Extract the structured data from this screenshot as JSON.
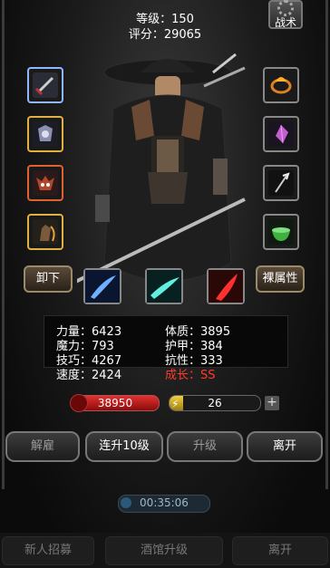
{
  "header": {
    "level_line": "等级：150",
    "score_line": "评分：29065",
    "tactics_label": "战术"
  },
  "equipment_left": [
    {
      "icon": "dagger-icon"
    },
    {
      "icon": "armor-icon"
    },
    {
      "icon": "demon-mask-icon"
    },
    {
      "icon": "claw-glove-icon"
    }
  ],
  "equipment_right": [
    {
      "icon": "fire-ring-icon"
    },
    {
      "icon": "crystal-gem-icon"
    },
    {
      "icon": "trident-icon"
    },
    {
      "icon": "jade-bowl-icon"
    }
  ],
  "buttons": {
    "unequip": "卸下",
    "base_attributes": "裸属性"
  },
  "skills": [
    "blue-slash-icon",
    "cyan-wind-icon",
    "red-blade-icon"
  ],
  "stats": [
    {
      "label": "力量：6423"
    },
    {
      "label": "体质：3895"
    },
    {
      "label": "魔力：793"
    },
    {
      "label": "护甲：384"
    },
    {
      "label": "技巧：4267"
    },
    {
      "label": "抗性：333"
    },
    {
      "label": "速度：2424"
    },
    {
      "label": "成长：SS"
    }
  ],
  "hp": {
    "value": "38950"
  },
  "energy": {
    "value": "26",
    "fraction": 0.15
  },
  "actions": {
    "dismiss": "解雇",
    "level_up_10": "连升10级",
    "upgrade": "升级",
    "leave": "离开"
  },
  "timer": "00:35:06",
  "bottom_nav": {
    "recruit": "新人招募",
    "tavern_upgrade": "酒馆升级",
    "leave": "离开"
  },
  "colors": {
    "growth_red": "#ff3a2a",
    "hp_red": "#d02020",
    "energy_yellow": "#e6c030"
  }
}
